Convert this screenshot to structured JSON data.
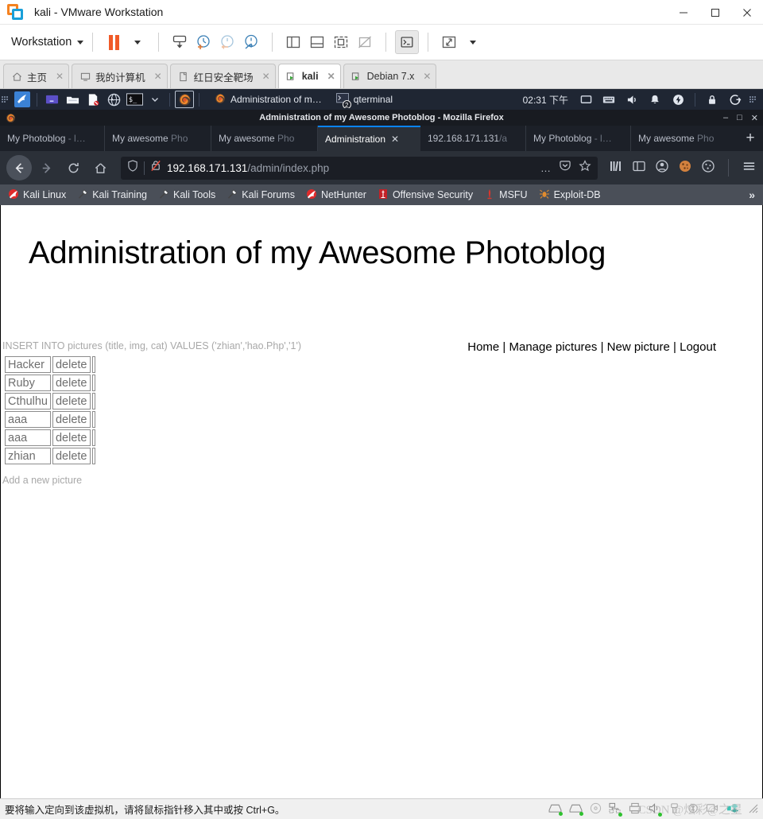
{
  "vmware": {
    "window_title": "kali - VMware Workstation",
    "logo_icon": "vmware-logo-icon",
    "window_buttons": [
      {
        "name": "minimize-button",
        "glyph": "–"
      },
      {
        "name": "maximize-button",
        "glyph": "❐"
      },
      {
        "name": "close-button",
        "glyph": "✕"
      }
    ],
    "toolbar": {
      "workstation_menu": "Workstation",
      "buttons": [
        {
          "name": "pause-button",
          "icon": "pause-icon"
        },
        {
          "name": "pause-dropdown",
          "icon": "chevron-down-icon"
        },
        {
          "name": "send-ctrl-alt-del-button",
          "icon": "keyboard-send-icon"
        },
        {
          "name": "take-snapshot-button",
          "icon": "snapshot-add-icon"
        },
        {
          "name": "revert-snapshot-button",
          "icon": "snapshot-revert-icon"
        },
        {
          "name": "snapshot-manager-button",
          "icon": "snapshot-manager-icon"
        },
        {
          "name": "show-sidebar-button",
          "icon": "sidebar-panel-icon"
        },
        {
          "name": "show-console-view-button",
          "icon": "bottom-panel-icon"
        },
        {
          "name": "fullscreen-button",
          "icon": "fullscreen-icon"
        },
        {
          "name": "unity-mode-button",
          "icon": "unity-off-icon"
        },
        {
          "name": "terminal-button",
          "icon": "terminal-icon"
        },
        {
          "name": "stretch-guest-button",
          "icon": "expand-arrows-icon"
        },
        {
          "name": "stretch-dropdown",
          "icon": "chevron-down-icon"
        }
      ]
    },
    "tabs": [
      {
        "label": "主页",
        "icon": "home-icon",
        "selected": false,
        "closable": true
      },
      {
        "label": "我的计算机",
        "icon": "monitor-icon",
        "selected": false,
        "closable": true
      },
      {
        "label": "红日安全靶场",
        "icon": "folder-tab-icon",
        "selected": false,
        "closable": true
      },
      {
        "label": "kali",
        "icon": "vm-running-icon",
        "selected": true,
        "closable": true
      },
      {
        "label": "Debian 7.x",
        "icon": "vm-running-icon",
        "selected": false,
        "closable": true
      }
    ],
    "statusbar": {
      "message": "要将输入定向到该虚拟机，请将鼠标指针移入其中或按 Ctrl+G。",
      "devices": [
        {
          "name": "hard-disk-1-indicator",
          "icon": "hard-disk-icon"
        },
        {
          "name": "hard-disk-2-indicator",
          "icon": "hard-disk-icon"
        },
        {
          "name": "cd-dvd-indicator",
          "icon": "cd-icon"
        },
        {
          "name": "network-adapter-indicator",
          "icon": "network-icon"
        },
        {
          "name": "printer-indicator",
          "icon": "printer-icon"
        },
        {
          "name": "sound-card-indicator",
          "icon": "speaker-icon"
        },
        {
          "name": "usb-indicator",
          "icon": "usb-icon"
        },
        {
          "name": "bluetooth-indicator",
          "icon": "bluetooth-icon"
        },
        {
          "name": "camera-indicator",
          "icon": "camera-icon"
        },
        {
          "name": "display-indicator",
          "icon": "display-icon"
        }
      ],
      "watermark": "CSDN @炫彩@之星"
    }
  },
  "kali": {
    "taskbar": {
      "launcher_icon": "kali-dragon-icon",
      "quick_launch": [
        {
          "name": "show-desktop-button",
          "icon": "desktop-icon"
        },
        {
          "name": "file-manager-button",
          "icon": "folder-icon"
        },
        {
          "name": "text-editor-button",
          "icon": "document-icon"
        },
        {
          "name": "web-browser-button",
          "icon": "globe-icon"
        },
        {
          "name": "terminal-launcher-button",
          "icon": "terminal-prompt-icon"
        },
        {
          "name": "launcher-dropdown",
          "icon": "chevron-down-icon"
        }
      ],
      "active_launcher": {
        "name": "firefox-launcher-button",
        "icon": "firefox-icon"
      },
      "tasks": [
        {
          "label": "Administration of m…",
          "icon": "firefox-icon",
          "active": true
        },
        {
          "label": "qterminal",
          "icon": "terminal-window-icon",
          "badge": "2",
          "active": false
        }
      ],
      "clock": "02:31 下午",
      "tray": [
        {
          "name": "display-tray-icon",
          "icon": "monitor-tray-icon"
        },
        {
          "name": "keyboard-layout-tray-icon",
          "icon": "keyboard-icon"
        },
        {
          "name": "volume-tray-icon",
          "icon": "speaker-icon"
        },
        {
          "name": "notifications-tray-icon",
          "icon": "bell-icon"
        },
        {
          "name": "power-tray-icon",
          "icon": "power-bolt-icon"
        },
        {
          "name": "lock-screen-button",
          "icon": "lock-icon"
        },
        {
          "name": "logout-button",
          "icon": "logout-icon"
        },
        {
          "name": "tray-grip",
          "icon": "grip-dots-icon"
        }
      ]
    }
  },
  "firefox": {
    "window_title": "Administration of my Awesome Photoblog - Mozilla Firefox",
    "app_icon": "firefox-icon",
    "window_buttons": [
      {
        "name": "firefox-minimize-button",
        "glyph": "–"
      },
      {
        "name": "firefox-maximize-button",
        "glyph": "□"
      },
      {
        "name": "firefox-close-button",
        "glyph": "✕"
      }
    ],
    "tabs": [
      {
        "title": "My Photoblog",
        "suffix": " - l…",
        "selected": false
      },
      {
        "title": "My awesome",
        "suffix": " Pho",
        "selected": false
      },
      {
        "title": "My awesome",
        "suffix": " Pho",
        "selected": false
      },
      {
        "title": "Administration",
        "suffix": "",
        "selected": true
      },
      {
        "title": "192.168.171.131",
        "suffix": "/a",
        "selected": false
      },
      {
        "title": "My Photoblog",
        "suffix": " - l…",
        "selected": false
      },
      {
        "title": "My awesome",
        "suffix": " Pho",
        "selected": false
      }
    ],
    "new_tab_label": "+",
    "nav": {
      "back_icon": "back-arrow-icon",
      "forward_icon": "forward-arrow-icon",
      "reload_icon": "reload-icon",
      "home_icon": "home-icon"
    },
    "urlbar": {
      "shield_icon": "shield-icon",
      "insecure_icon": "insecure-lock-icon",
      "host": "192.168.171.131",
      "path": "/admin/index.php",
      "page_actions_icon": "ellipsis-icon",
      "pocket_icon": "pocket-icon",
      "bookmark_star_icon": "star-icon"
    },
    "toolbar_icons": [
      {
        "name": "library-button",
        "icon": "library-icon"
      },
      {
        "name": "sidebars-button",
        "icon": "sidebar-icon"
      },
      {
        "name": "account-button",
        "icon": "account-circle-icon"
      },
      {
        "name": "cookie-manager-button",
        "icon": "cookie-icon"
      },
      {
        "name": "cookie-quick-manager-button",
        "icon": "cookie-outline-icon"
      },
      {
        "name": "app-menu-button",
        "icon": "hamburger-icon"
      }
    ],
    "bookmarks": [
      {
        "label": "Kali Linux",
        "icon": "kali-bookmark-icon"
      },
      {
        "label": "Kali Training",
        "icon": "kali-tool-icon"
      },
      {
        "label": "Kali Tools",
        "icon": "kali-tool-icon"
      },
      {
        "label": "Kali Forums",
        "icon": "kali-tool-icon"
      },
      {
        "label": "NetHunter",
        "icon": "kali-bookmark-icon"
      },
      {
        "label": "Offensive Security",
        "icon": "offsec-icon"
      },
      {
        "label": "MSFU",
        "icon": "metasploit-icon"
      },
      {
        "label": "Exploit-DB",
        "icon": "exploitdb-icon"
      }
    ],
    "bookmarks_overflow": "»"
  },
  "page": {
    "heading": "Administration of my Awesome Photoblog",
    "sql_message": "INSERT INTO pictures (title, img, cat) VALUES ('zhian','hao.Php','1')",
    "table": {
      "rows": [
        {
          "title": "Hacker",
          "action": "delete"
        },
        {
          "title": "Ruby",
          "action": "delete"
        },
        {
          "title": "Cthulhu",
          "action": "delete"
        },
        {
          "title": "aaa",
          "action": "delete"
        },
        {
          "title": "aaa",
          "action": "delete"
        },
        {
          "title": "zhian",
          "action": "delete"
        }
      ]
    },
    "add_link": "Add a new picture",
    "nav_links": [
      "Home",
      "Manage pictures",
      "New picture",
      "Logout"
    ],
    "nav_separator": "|"
  },
  "colors": {
    "vmware_orange": "#f05a28",
    "vmware_blue": "#1a9fd9",
    "firefox_selected_tab": "#2b3038",
    "firefox_tab_accent": "#0a84ff",
    "kali_taskbar": "#1f2633",
    "bookmarks_bar": "#4a4f58"
  }
}
